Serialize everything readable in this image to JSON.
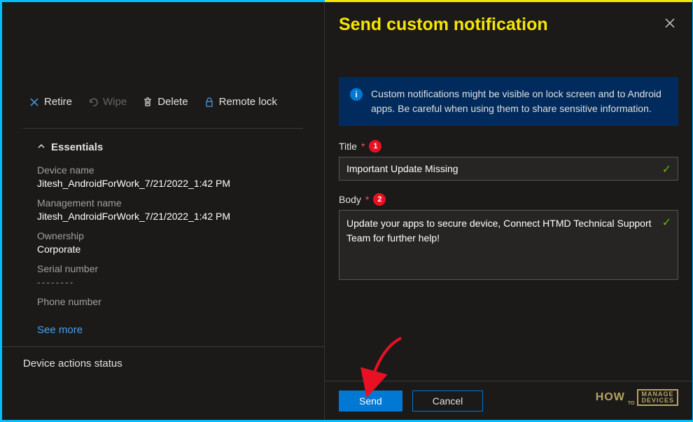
{
  "toolbar": {
    "retire": "Retire",
    "wipe": "Wipe",
    "delete": "Delete",
    "remote_lock": "Remote lock"
  },
  "essentials": {
    "header": "Essentials",
    "fields": [
      {
        "label": "Device name",
        "value": "Jitesh_AndroidForWork_7/21/2022_1:42 PM"
      },
      {
        "label": "Management name",
        "value": "Jitesh_AndroidForWork_7/21/2022_1:42 PM"
      },
      {
        "label": "Ownership",
        "value": "Corporate"
      },
      {
        "label": "Serial number",
        "value": ""
      },
      {
        "label": "Phone number",
        "value": ""
      }
    ],
    "see_more": "See more"
  },
  "section_footer": "Device actions status",
  "panel": {
    "title": "Send custom notification",
    "info_text": "Custom notifications might be visible on lock screen and to Android apps. Be careful when using them to share sensitive information.",
    "title_label": "Title",
    "title_value": "Important Update Missing",
    "body_label": "Body",
    "body_value": "Update your apps to secure device, Connect HTMD Technical Support Team for further help!",
    "badge1": "1",
    "badge2": "2",
    "send": "Send",
    "cancel": "Cancel"
  },
  "logo": {
    "how": "HOW",
    "to": "TO",
    "manage": "MANAGE",
    "devices": "DEVICES"
  }
}
